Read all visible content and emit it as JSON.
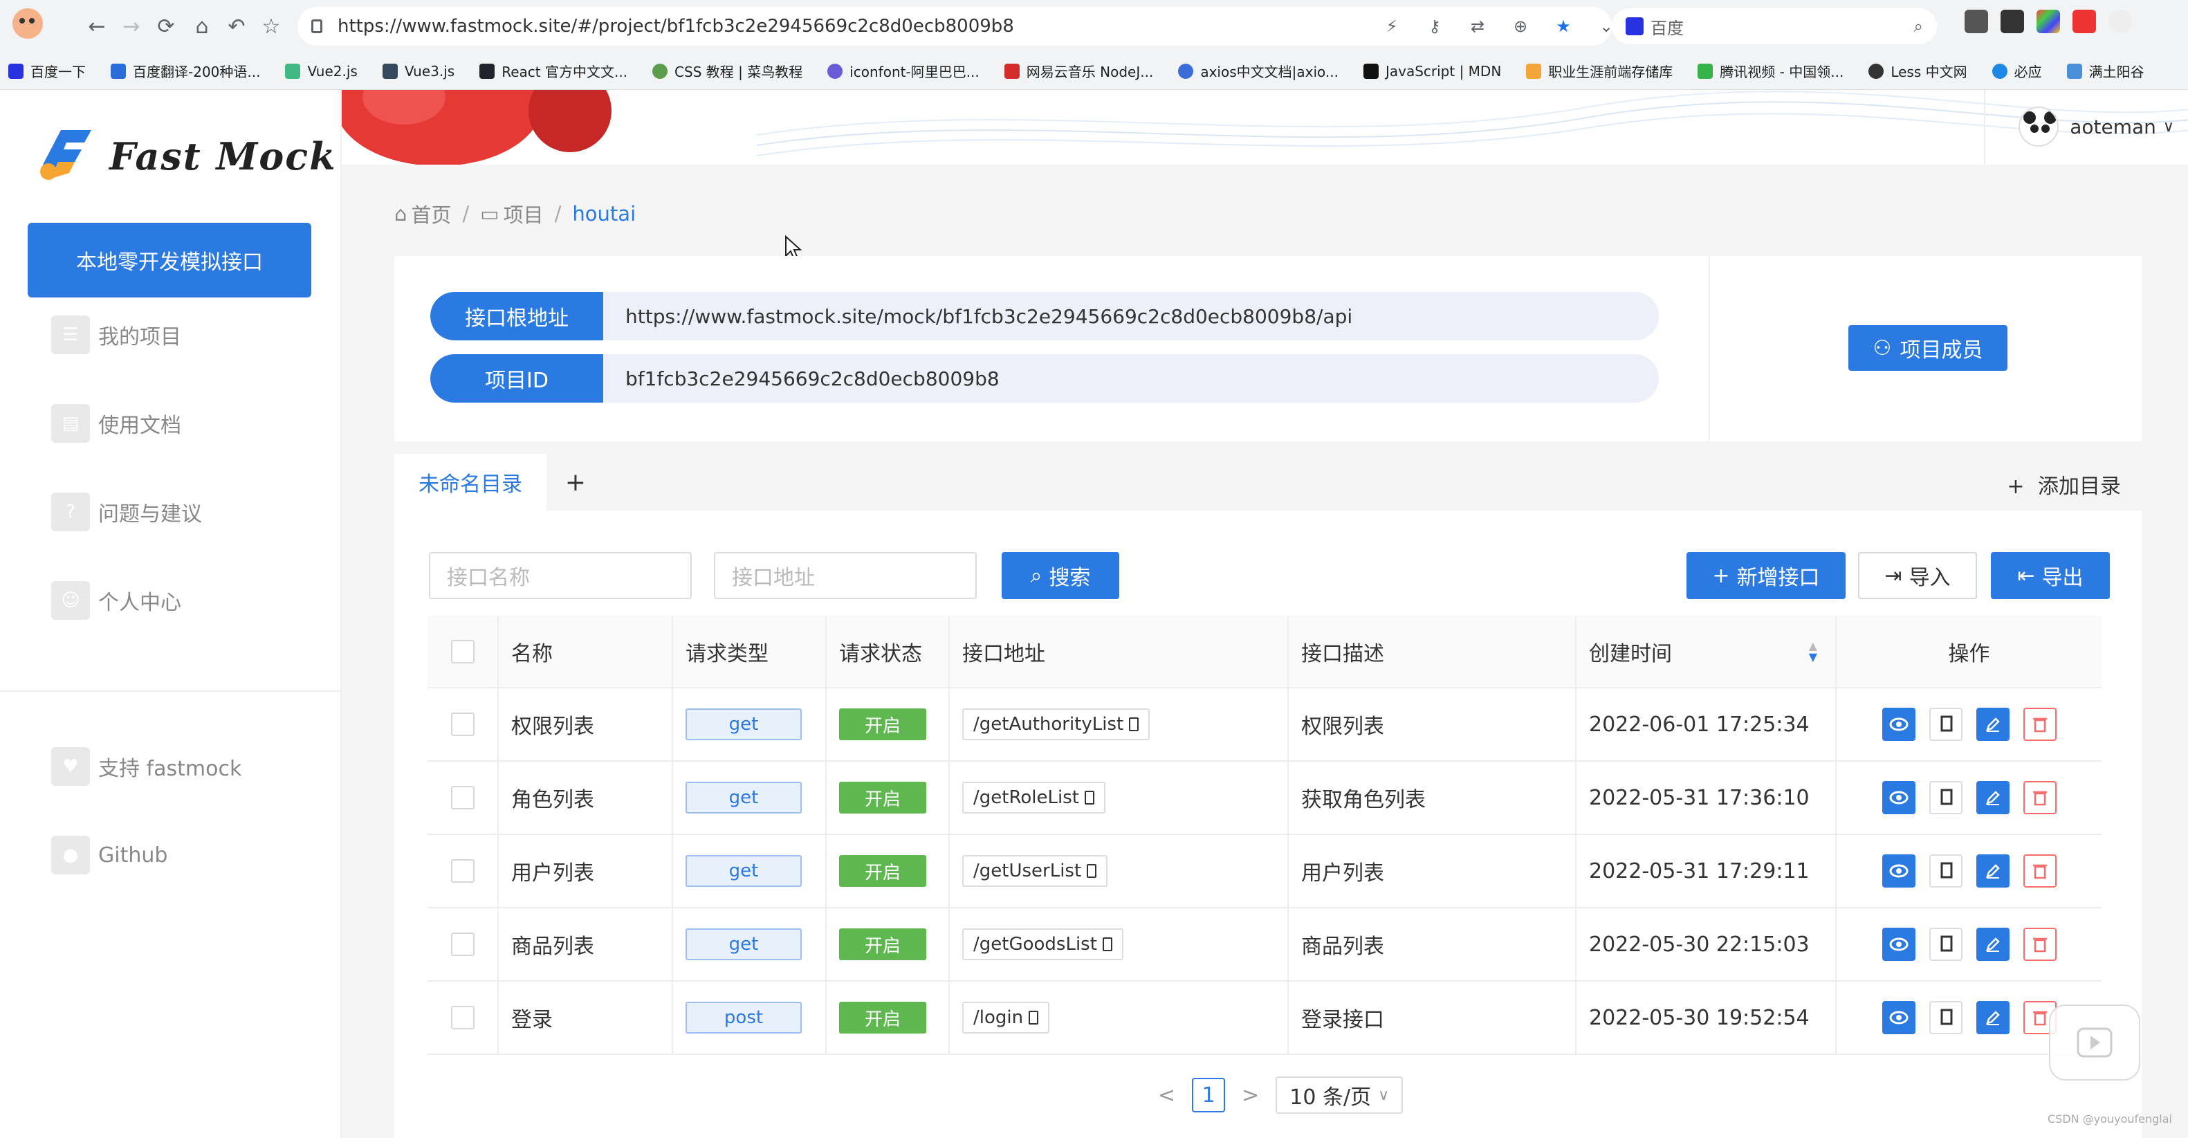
{
  "browser": {
    "url": "https://www.fastmock.site/#/project/bf1fcb3c2e2945669c2c8d0ecb8009b8",
    "search_engine": "百度",
    "bookmarks": [
      "百度一下",
      "百度翻译-200种语...",
      "Vue2.js",
      "Vue3.js",
      "React 官方中文文...",
      "CSS 教程 | 菜鸟教程",
      "iconfont-阿里巴巴...",
      "网易云音乐 NodeJ...",
      "axios中文文档|axio...",
      "JavaScript | MDN",
      "职业生涯前端存储库",
      "腾讯视频 - 中国领...",
      "Less 中文网",
      "必应",
      "满土阳谷"
    ]
  },
  "app": {
    "brand": "Fast Mock",
    "cta": "本地零开发模拟接口",
    "nav": [
      {
        "label": "我的项目",
        "icon": "list-icon"
      },
      {
        "label": "使用文档",
        "icon": "document-icon"
      },
      {
        "label": "问题与建议",
        "icon": "question-icon"
      },
      {
        "label": "个人中心",
        "icon": "user-icon"
      }
    ],
    "nav_bottom": [
      {
        "label": "支持 fastmock",
        "icon": "heart-icon"
      },
      {
        "label": "Github",
        "icon": "github-icon"
      }
    ],
    "user": "aoteman"
  },
  "breadcrumb": {
    "home": "首页",
    "projects": "项目",
    "current": "houtai"
  },
  "info": {
    "root_label": "接口根地址",
    "root_value": "https://www.fastmock.site/mock/bf1fcb3c2e2945669c2c8d0ecb8009b8/api",
    "id_label": "项目ID",
    "id_value": "bf1fcb3c2e2945669c2c8d0ecb8009b8",
    "members_button": "项目成员"
  },
  "tabs": {
    "active": "未命名目录",
    "add": "+",
    "add_directory": "添加目录"
  },
  "search": {
    "name_placeholder": "接口名称",
    "path_placeholder": "接口地址",
    "search_button": "搜索",
    "new_button": "新增接口",
    "import_button": "导入",
    "export_button": "导出"
  },
  "table": {
    "columns": [
      "名称",
      "请求类型",
      "请求状态",
      "接口地址",
      "接口描述",
      "创建时间",
      "操作"
    ],
    "rows": [
      {
        "name": "权限列表",
        "method": "get",
        "status": "开启",
        "path": "/getAuthorityList",
        "desc": "权限列表",
        "created": "2022-06-01 17:25:34"
      },
      {
        "name": "角色列表",
        "method": "get",
        "status": "开启",
        "path": "/getRoleList",
        "desc": "获取角色列表",
        "created": "2022-05-31 17:36:10"
      },
      {
        "name": "用户列表",
        "method": "get",
        "status": "开启",
        "path": "/getUserList",
        "desc": "用户列表",
        "created": "2022-05-31 17:29:11"
      },
      {
        "name": "商品列表",
        "method": "get",
        "status": "开启",
        "path": "/getGoodsList",
        "desc": "商品列表",
        "created": "2022-05-30 22:15:03"
      },
      {
        "name": "登录",
        "method": "post",
        "status": "开启",
        "path": "/login",
        "desc": "登录接口",
        "created": "2022-05-30 19:52:54"
      }
    ]
  },
  "pager": {
    "prev": "<",
    "page": "1",
    "next": ">",
    "size": "10 条/页"
  },
  "watermark": "CSDN @youyoufenglai",
  "colors": {
    "primary": "#2a7ae2",
    "success": "#5fb84f",
    "danger": "#f56c6c"
  }
}
